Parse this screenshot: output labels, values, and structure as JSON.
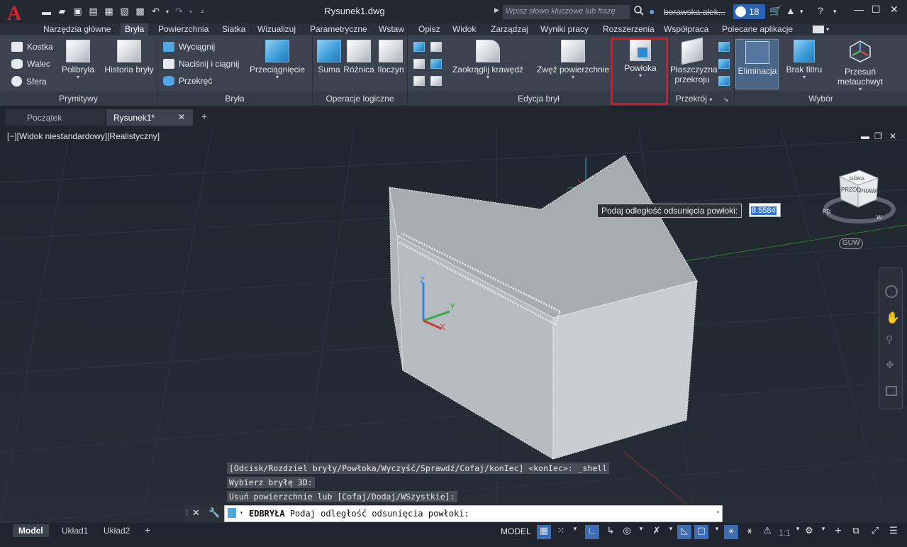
{
  "app": {
    "logo_letter": "A",
    "title": "Rysunek1.dwg",
    "search_placeholder": "Wpisz słowo kluczowe lub frazę",
    "user": "borawska.alek...",
    "notifications": "18"
  },
  "ribbon_tabs": [
    "Narzędzia główne",
    "Bryła",
    "Powierzchnia",
    "Siatka",
    "Wizualizuj",
    "Parametryczne",
    "Wstaw",
    "Opisz",
    "Widok",
    "Zarządzaj",
    "Wyniki pracy",
    "Rozszerzenia",
    "Współpraca",
    "Polecane aplikacje"
  ],
  "active_tab": "Bryła",
  "ribbon": {
    "prymitywy": {
      "title": "Prymitywy",
      "small": [
        "Kostka",
        "Walec",
        "Sfera"
      ],
      "polibryla": "Polibryła",
      "historia": "Historia bryły"
    },
    "bryla": {
      "title": "Bryła",
      "small": [
        "Wyciągnij",
        "Naciśnij i ciągnij",
        "Przekręć"
      ],
      "przeciagniecie": "Przeciągnięcie"
    },
    "operacje": {
      "title": "Operacje logiczne",
      "suma": "Suma",
      "roznica": "Różnica",
      "iloczyn": "Iloczyn"
    },
    "edycja": {
      "title": "Edycja brył",
      "zaokraglij": "Zaokrąglij krawędź",
      "zwez": "Zwęź powierzchnie",
      "powloka": "Powłoka"
    },
    "przekroj": {
      "title": "Przekrój",
      "plaszczyzna_1": "Płaszczyzna",
      "plaszczyzna_2": "przekroju"
    },
    "wybor": {
      "title": "Wybór",
      "eliminacja": "Eliminacja",
      "brak_filtru": "Brak filtru",
      "przesun_1": "Przesuń",
      "przesun_2": "metauchwyt"
    }
  },
  "file_tabs": {
    "start": "Początek",
    "drawing": "Rysunek1*"
  },
  "viewport": {
    "label": "[−][Widok niestandardowy][Realistyczny]",
    "prompt": "Podaj odległość odsunięcia powłoki:",
    "input_value": "8.5584",
    "viewcube_top": "GÓRA",
    "viewcube_front": "PRZÓD",
    "viewcube_right": "PRAWO",
    "compass_s": "PD",
    "compass_w": "W",
    "wcs": "GUW",
    "axis_x": "X",
    "axis_y": "Y",
    "axis_z": "Z"
  },
  "command": {
    "history": [
      "[Odcisk/Rozdziel bryły/Powłoka/Wyczyść/Sprawdź/Cofaj/konIec] <konIec>: _shell",
      "Wybierz bryłę 3D:",
      "Usuń powierzchnie lub [Cofaj/Dodaj/WSzystkie]:"
    ],
    "current_cmd": "EDBRYŁA",
    "current_prompt": "Podaj odległość odsunięcia powłoki:"
  },
  "layout_tabs": [
    "Model",
    "Układ1",
    "Układ2"
  ],
  "status": {
    "model": "MODEL",
    "scale": "1:1"
  }
}
